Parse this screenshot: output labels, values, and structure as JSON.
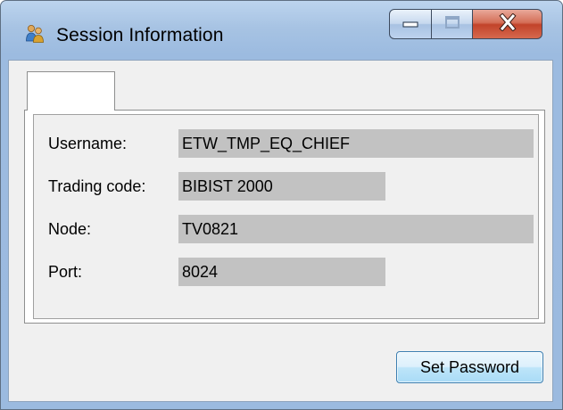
{
  "window": {
    "title": "Session Information"
  },
  "tabs": [
    {
      "label": ""
    }
  ],
  "fields": {
    "username": {
      "label": "Username:",
      "value": "ETW_TMP_EQ_CHIEF"
    },
    "trading_code": {
      "label": "Trading code:",
      "value": "BIBIST 2000"
    },
    "node": {
      "label": "Node:",
      "value": "TV0821"
    },
    "port": {
      "label": "Port:",
      "value": "8024"
    }
  },
  "actions": {
    "set_password_label": "Set Password"
  },
  "icons": {
    "app": "users-icon",
    "minimize": "minimize-icon",
    "maximize": "maximize-icon",
    "close": "close-icon"
  },
  "colors": {
    "close_button": "#c2432a",
    "field_background": "#c2c2c2"
  }
}
